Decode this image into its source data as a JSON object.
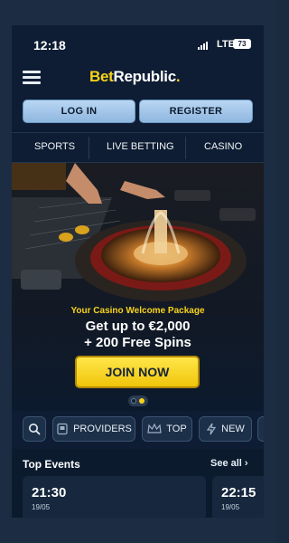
{
  "status_bar": {
    "time": "12:18",
    "network": "LTE",
    "battery": "73"
  },
  "header": {
    "logo_bet": "Bet",
    "logo_republic": "Republic",
    "logo_dot": "."
  },
  "auth": {
    "login_label": "LOG IN",
    "register_label": "REGISTER"
  },
  "nav": {
    "items": [
      {
        "label": "SPORTS"
      },
      {
        "label": "LIVE BETTING"
      },
      {
        "label": "CASINO"
      }
    ]
  },
  "promo": {
    "subtitle": "Your Casino Welcome Package",
    "line1": "Get up to €2,000",
    "line2": "+ 200 Free Spins",
    "cta_label": "JOIN NOW",
    "carousel": {
      "slides": 2,
      "active_slide": 2
    }
  },
  "filters": {
    "search_icon": "search-icon",
    "items": [
      {
        "label": "PROVIDERS",
        "icon": "providers-icon"
      },
      {
        "label": "TOP",
        "icon": "crown-icon"
      },
      {
        "label": "NEW",
        "icon": "lightning-icon"
      }
    ]
  },
  "events": {
    "title": "Top Events",
    "see_all_label": "See all",
    "cards": [
      {
        "time": "21:30",
        "date": "19/05"
      },
      {
        "time": "22:15",
        "date": "19/05"
      }
    ]
  },
  "colors": {
    "brand_yellow": "#f8d21a",
    "background": "#0c1a2e",
    "button_blue": "#a6c7ea"
  }
}
